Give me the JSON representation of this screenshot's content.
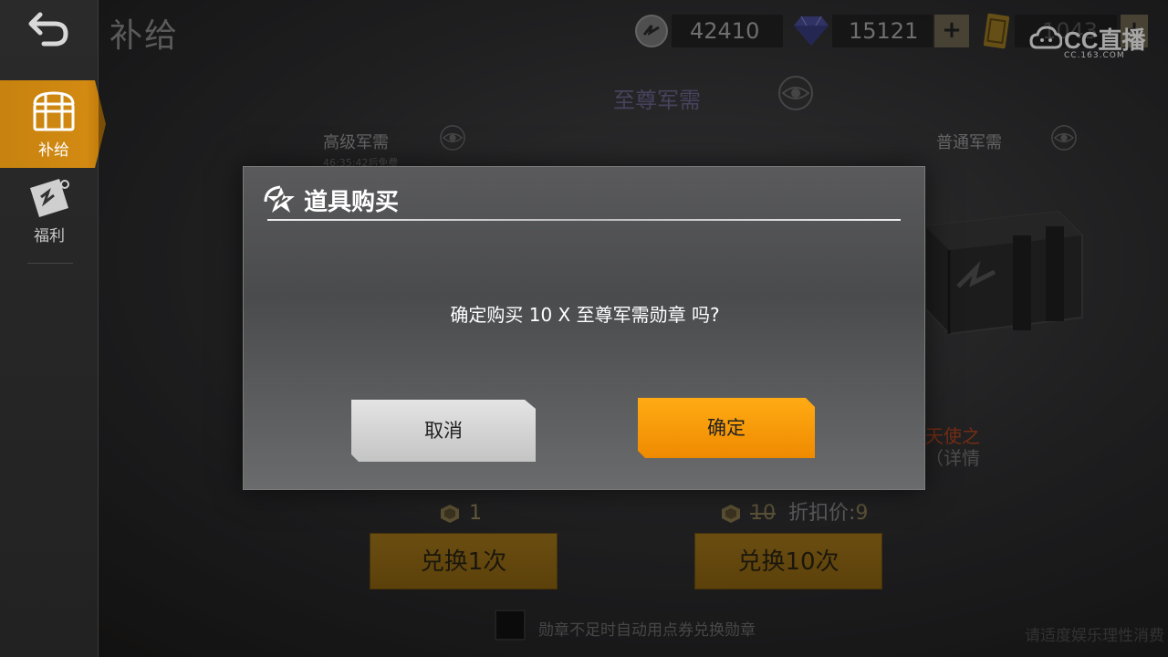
{
  "page": {
    "title": "补给"
  },
  "sidebar": {
    "items": [
      {
        "label": "补给",
        "icon": "chest-icon",
        "active": true
      },
      {
        "label": "福利",
        "icon": "ticket-icon",
        "active": false
      }
    ]
  },
  "currency": {
    "silver": {
      "icon": "silver-coin-icon",
      "value": "42410"
    },
    "diamond": {
      "icon": "diamond-icon",
      "value": "15121"
    },
    "voucher": {
      "icon": "voucher-icon",
      "value": "1043"
    }
  },
  "watermark": {
    "main": "CC直播",
    "sub": "CC.163.COM"
  },
  "store": {
    "premium_supply": "至尊军需",
    "advanced_supply": "高级军需",
    "advanced_timer": "46:35:42后免费",
    "normal_supply": "普通军需",
    "angel_text": "天使之",
    "detail_text": "（详情",
    "cost_single": "1",
    "cost_ten": "10",
    "discount_label": "折扣价:",
    "discount_value": "9",
    "exchange_once": "兑换1次",
    "exchange_ten": "兑换10次",
    "auto_exchange_label": "勋章不足时自动用点券兑换勋章",
    "footer_note": "请适度娱乐理性消费"
  },
  "modal": {
    "title": "道具购买",
    "message": "确定购买 10 X 至尊军需勋章 吗?",
    "cancel_label": "取消",
    "confirm_label": "确定"
  },
  "colors": {
    "accent_orange": "#f39a0a",
    "sidebar_active": "#c7820f",
    "exchange_button": "#9a6f16"
  }
}
